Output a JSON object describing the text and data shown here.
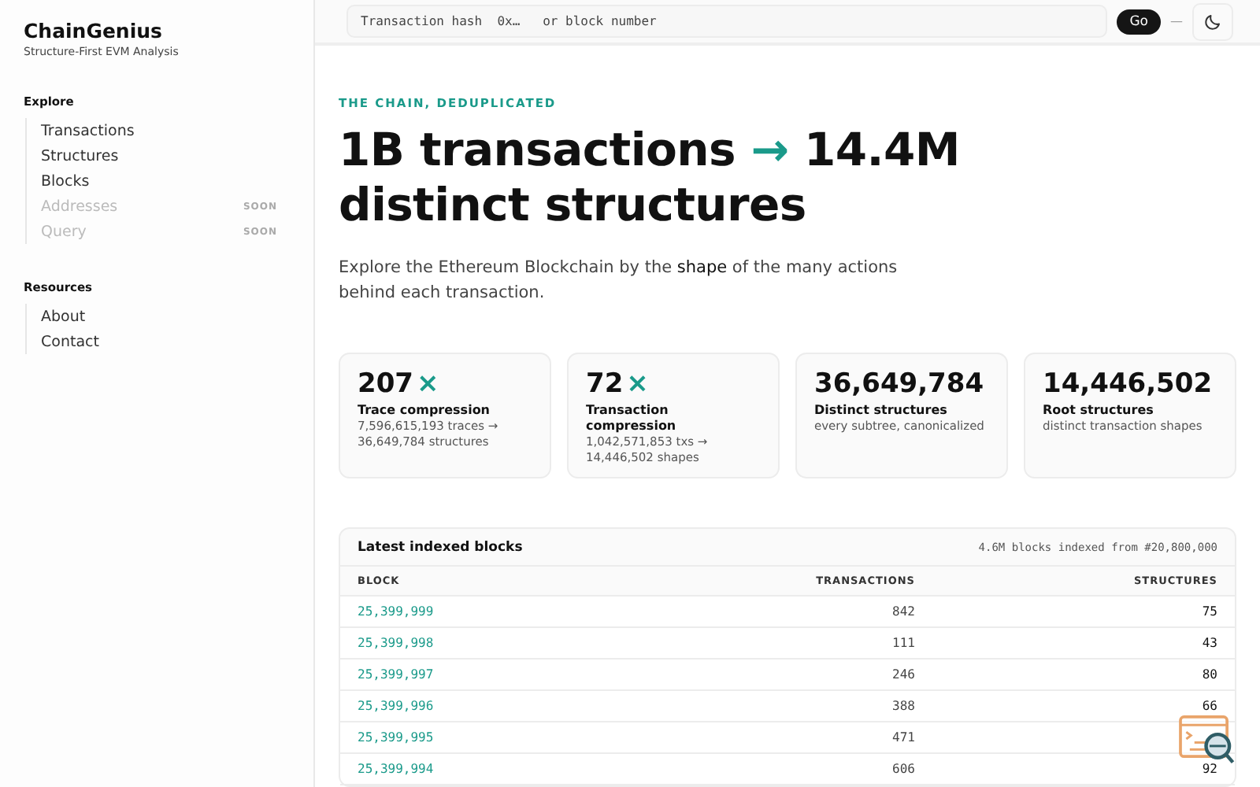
{
  "sidebar": {
    "brand": "ChainGenius",
    "tagline": "Structure-First EVM Analysis",
    "sections": [
      {
        "title": "Explore",
        "items": [
          {
            "label": "Transactions",
            "disabled": false
          },
          {
            "label": "Structures",
            "disabled": false
          },
          {
            "label": "Blocks",
            "disabled": false
          },
          {
            "label": "Addresses",
            "disabled": true,
            "badge": "SOON"
          },
          {
            "label": "Query",
            "disabled": true,
            "badge": "SOON"
          }
        ]
      },
      {
        "title": "Resources",
        "items": [
          {
            "label": "About",
            "disabled": false
          },
          {
            "label": "Contact",
            "disabled": false
          }
        ]
      }
    ]
  },
  "topbar": {
    "search": {
      "placeholder": "Transaction hash  0x…   or block number"
    },
    "go": "Go",
    "separator": "—"
  },
  "hero": {
    "eyebrow": "THE CHAIN, DEDUPLICATED",
    "headline": [
      {
        "kind": "plain",
        "text": "1B transactions "
      },
      {
        "kind": "accent",
        "text": "→"
      },
      {
        "kind": "plain",
        "text": " 14.4M distinct structures"
      }
    ],
    "lead": "Explore the Ethereum Blockchain by the **shape** of the many actions behind each transaction."
  },
  "stats": [
    {
      "value": "207",
      "suffix": "×",
      "label": "Trace compression",
      "detail": "7,596,615,193 traces → 36,649,784 structures"
    },
    {
      "value": "72",
      "suffix": "×",
      "label": "Transaction compression",
      "detail": "1,042,571,853 txs → 14,446,502 shapes"
    },
    {
      "value": "36,649,784",
      "label": "Distinct structures",
      "detail": "every subtree, canonicalized"
    },
    {
      "value": "14,446,502",
      "label": "Root structures",
      "detail": "distinct transaction shapes"
    }
  ],
  "blocks": {
    "title": "Latest indexed blocks",
    "note": "4.6M blocks indexed from #20,800,000",
    "columns": [
      "BLOCK",
      "TRANSACTIONS",
      "STRUCTURES"
    ],
    "rows": [
      {
        "block": "25,399,999",
        "transactions": "842",
        "structures": "75"
      },
      {
        "block": "25,399,998",
        "transactions": "111",
        "structures": "43"
      },
      {
        "block": "25,399,997",
        "transactions": "246",
        "structures": "80"
      },
      {
        "block": "25,399,996",
        "transactions": "388",
        "structures": "66"
      },
      {
        "block": "25,399,995",
        "transactions": "471"
      },
      {
        "block": "25,399,994",
        "transactions": "606",
        "structures": "92"
      }
    ]
  }
}
